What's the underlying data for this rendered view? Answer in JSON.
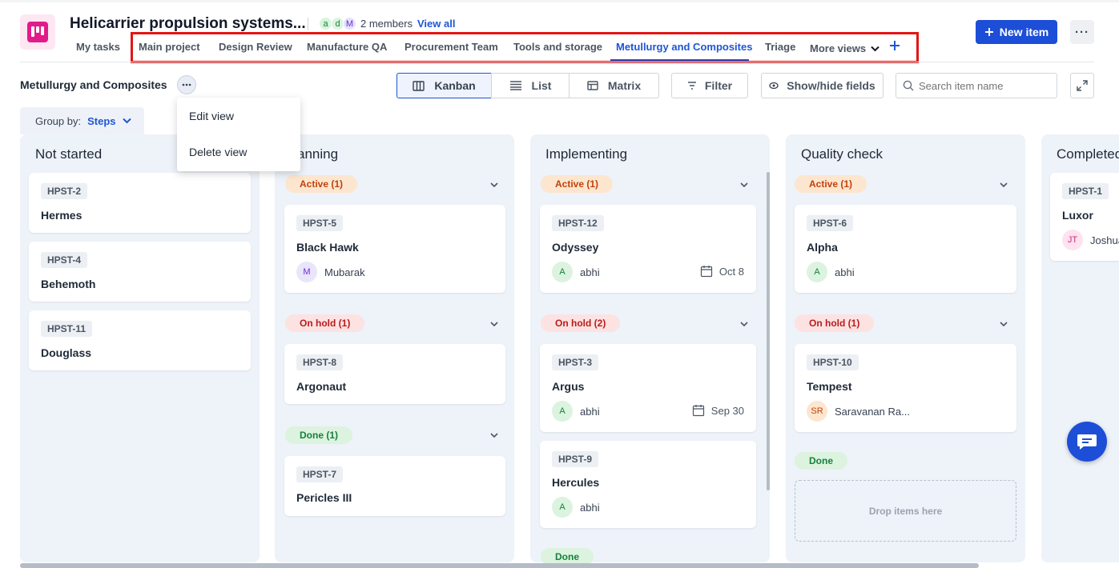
{
  "project": {
    "title": "Helicarrier propulsion systems...",
    "member_initials": [
      "a",
      "d",
      "M"
    ],
    "members_text": "2 members",
    "view_all": "View all",
    "new_item": "New item",
    "more_menu": "···"
  },
  "tabs": [
    {
      "label": "My tasks"
    },
    {
      "label": "Main project"
    },
    {
      "label": "Design Review"
    },
    {
      "label": "Manufacture QA"
    },
    {
      "label": "Procurement Team"
    },
    {
      "label": "Tools and storage"
    },
    {
      "label": "Metullurgy and Composites",
      "active": true
    },
    {
      "label": "Triage"
    },
    {
      "label": "More views"
    }
  ],
  "toolbar": {
    "view_title": "Metullurgy and Composites",
    "kanban": "Kanban",
    "list": "List",
    "matrix": "Matrix",
    "filter": "Filter",
    "show_hide": "Show/hide fields",
    "search_placeholder": "Search item name"
  },
  "group_by": {
    "label": "Group by:",
    "value": "Steps"
  },
  "view_menu": {
    "edit": "Edit view",
    "delete": "Delete view"
  },
  "columns": {
    "not_started": {
      "title": "Not started",
      "cards": [
        {
          "id": "HPST-2",
          "name": "Hermes"
        },
        {
          "id": "HPST-4",
          "name": "Behemoth"
        },
        {
          "id": "HPST-11",
          "name": "Douglass"
        }
      ]
    },
    "planning": {
      "title": "anning",
      "groups": {
        "active": "Active (1)",
        "on_hold": "On hold (1)",
        "done": "Done (1)"
      },
      "cards": [
        {
          "id": "HPST-5",
          "name": "Black Hawk",
          "assignee": "Mubarak",
          "initial": "M"
        },
        {
          "id": "HPST-8",
          "name": "Argonaut"
        },
        {
          "id": "HPST-7",
          "name": "Pericles III"
        }
      ]
    },
    "implementing": {
      "title": "Implementing",
      "groups": {
        "active": "Active (1)",
        "on_hold": "On hold (2)",
        "done": "Done"
      },
      "cards": [
        {
          "id": "HPST-12",
          "name": "Odyssey",
          "assignee": "abhi",
          "initial": "A",
          "date": "Oct 8"
        },
        {
          "id": "HPST-3",
          "name": "Argus",
          "assignee": "abhi",
          "initial": "A",
          "date": "Sep 30"
        },
        {
          "id": "HPST-9",
          "name": "Hercules",
          "assignee": "abhi",
          "initial": "A"
        }
      ]
    },
    "quality_check": {
      "title": "Quality check",
      "groups": {
        "active": "Active (1)",
        "on_hold": "On hold (1)",
        "done": "Done"
      },
      "cards": [
        {
          "id": "HPST-6",
          "name": "Alpha",
          "assignee": "abhi",
          "initial": "A"
        },
        {
          "id": "HPST-10",
          "name": "Tempest",
          "assignee": "Saravanan Ra...",
          "initial": "SR"
        }
      ],
      "drop_text": "Drop items here"
    },
    "completed": {
      "title": "Completed",
      "cards": [
        {
          "id": "HPST-1",
          "name": "Luxor",
          "assignee": "Joshua",
          "initial": "JT"
        }
      ]
    }
  },
  "colors": {
    "accent": "#1e56d6",
    "brand": "#e21b8a",
    "highlight_box": "#e31515"
  }
}
